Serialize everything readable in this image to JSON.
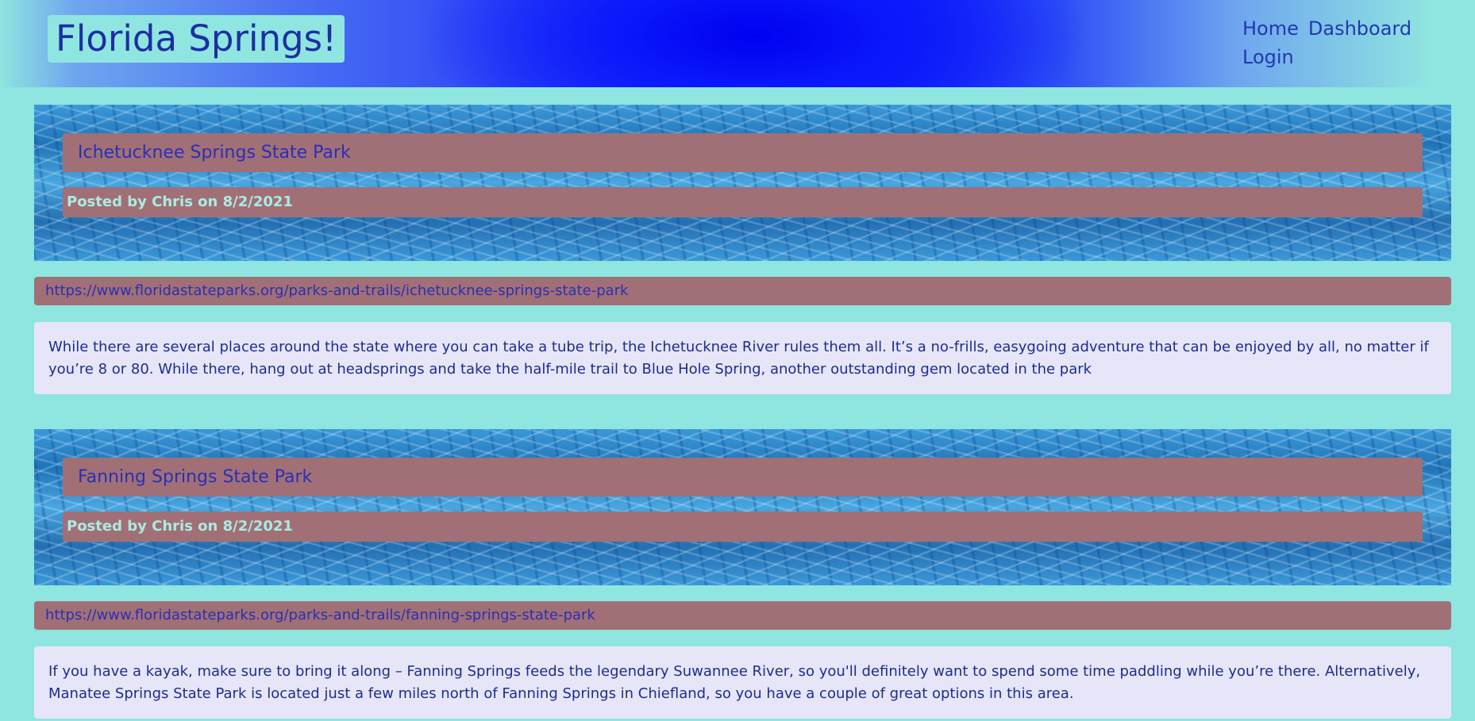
{
  "header": {
    "site_title": "Florida Springs!",
    "nav": [
      {
        "label": "Home"
      },
      {
        "label": "Dashboard"
      },
      {
        "label": "Login"
      }
    ]
  },
  "posts": [
    {
      "title": "Ichetucknee Springs State Park",
      "meta": "Posted by Chris on 8/2/2021",
      "url": "https://www.floridastateparks.org/parks-and-trails/ichetucknee-springs-state-park",
      "body": "While there are several places around the state where you can take a tube trip, the Ichetucknee River rules them all. It’s a no-frills, easygoing adventure that can be enjoyed by all, no matter if you’re 8 or 80. While there, hang out at headsprings and take the half-mile trail to Blue Hole Spring, another outstanding gem located in the park"
    },
    {
      "title": "Fanning Springs State Park",
      "meta": "Posted by Chris on 8/2/2021",
      "url": "https://www.floridastateparks.org/parks-and-trails/fanning-springs-state-park",
      "body": "If you have a kayak, make sure to bring it along – Fanning Springs feeds the legendary Suwannee River, so you'll definitely want to spend some time paddling while you’re there. Alternatively, Manatee Springs State Park is located just a few miles north of Fanning Springs in Chiefland, so you have a couple of great options in this area."
    }
  ],
  "colors": {
    "page_background": "#8fe5e0",
    "card_accent": "#a17076",
    "body_panel": "#e6e6f8",
    "link_text": "#2a2fb5",
    "header_blue": "#0f1ffa"
  }
}
